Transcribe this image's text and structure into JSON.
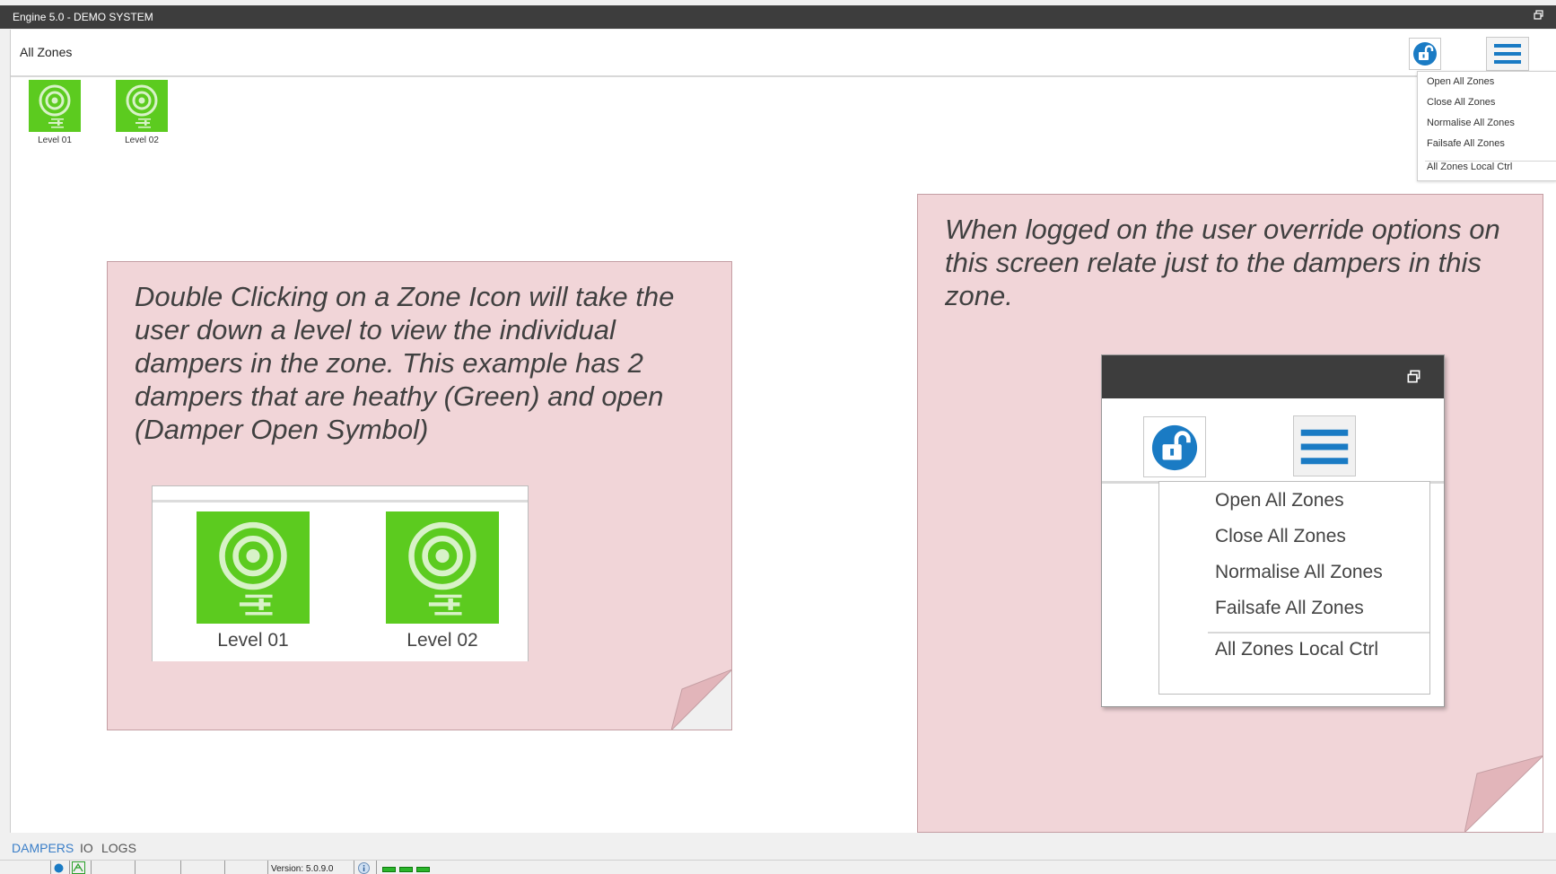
{
  "window": {
    "title": "Engine 5.0 - DEMO SYSTEM"
  },
  "header": {
    "breadcrumb": "All Zones"
  },
  "toolbar": {
    "lock_icon": "unlock-icon",
    "menu_icon": "hamburger-menu-icon"
  },
  "dropdown": {
    "items": [
      "Open All Zones",
      "Close All Zones",
      "Normalise All Zones",
      "Failsafe All Zones",
      "All Zones Local Ctrl"
    ]
  },
  "zones": [
    {
      "label": "Level 01",
      "status_color": "#5ccb1f",
      "icon": "damper-open-icon"
    },
    {
      "label": "Level 02",
      "status_color": "#5ccb1f",
      "icon": "damper-open-icon"
    }
  ],
  "notes": {
    "left": "Double Clicking on a Zone Icon will take the user down a level to view the individual dampers in the zone.   This example has 2 dampers that are heathy (Green) and open (Damper Open Symbol)",
    "right": "When logged on the user override options on this screen relate just to the dampers in this zone."
  },
  "tabs": [
    "DAMPERS",
    "IO",
    "LOGS"
  ],
  "active_tab": "DAMPERS",
  "status": {
    "version": "Version: 5.0.9.0"
  },
  "colors": {
    "accent": "#1a7bc4",
    "healthy": "#5ccb1f",
    "note_bg": "#f1d5d8"
  }
}
